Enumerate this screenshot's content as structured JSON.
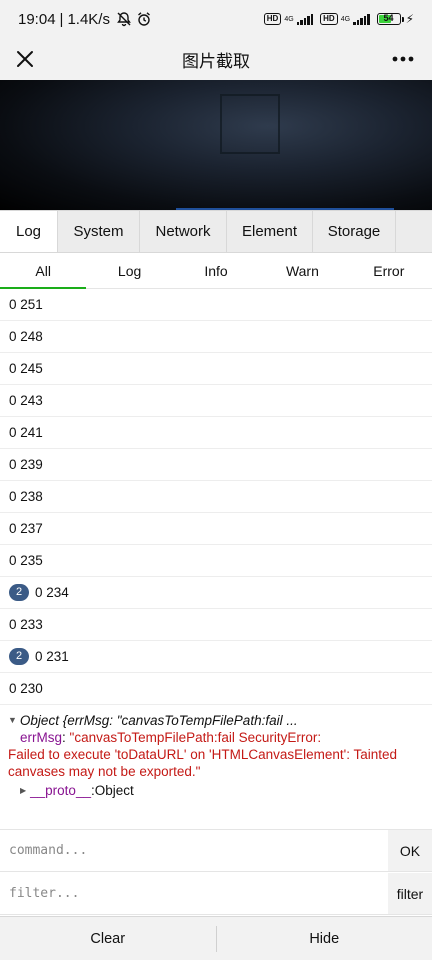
{
  "status_bar": {
    "time": "19:04",
    "speed": "1.4K/s",
    "mute_icon": "bell-off-icon",
    "alarm_icon": "alarm-icon",
    "hd1": "HD",
    "net1": "4G",
    "hd2": "HD",
    "net2": "4G",
    "battery": "54"
  },
  "nav": {
    "title": "图片截取",
    "close_icon": "close-icon",
    "more_icon": "more-icon"
  },
  "tabs": [
    {
      "label": "Log",
      "active": true
    },
    {
      "label": "System"
    },
    {
      "label": "Network"
    },
    {
      "label": "Element"
    },
    {
      "label": "Storage"
    }
  ],
  "subtabs": [
    {
      "label": "All",
      "active": true
    },
    {
      "label": "Log"
    },
    {
      "label": "Info"
    },
    {
      "label": "Warn"
    },
    {
      "label": "Error"
    }
  ],
  "logs": [
    {
      "text": "0 251"
    },
    {
      "text": "0 248"
    },
    {
      "text": "0 245"
    },
    {
      "text": "0 243"
    },
    {
      "text": "0 241"
    },
    {
      "text": "0 239"
    },
    {
      "text": "0 238"
    },
    {
      "text": "0 237"
    },
    {
      "text": "0 235"
    },
    {
      "text": "0 234",
      "repeat": "2"
    },
    {
      "text": "0 233"
    },
    {
      "text": "0 231",
      "repeat": "2"
    },
    {
      "text": "0 230"
    }
  ],
  "object_log": {
    "summary": "Object {errMsg: \"canvasToTempFilePath:fail ...",
    "key": "errMsg",
    "value_line1": "\"canvasToTempFilePath:fail SecurityError:",
    "value_rest": "Failed to execute 'toDataURL' on 'HTMLCanvasElement': Tainted canvases may not be exported.\"",
    "proto_key": "__proto__",
    "proto_value": "Object"
  },
  "command": {
    "placeholder": "command...",
    "button": "OK"
  },
  "filter": {
    "placeholder": "filter...",
    "button": "filter"
  },
  "bottom": {
    "clear": "Clear",
    "hide": "Hide"
  },
  "colors": {
    "active_subtab_underline": "#1aad19",
    "repeat_badge": "#3b5b86",
    "error_text": "#c41a16",
    "key_text": "#881391"
  }
}
